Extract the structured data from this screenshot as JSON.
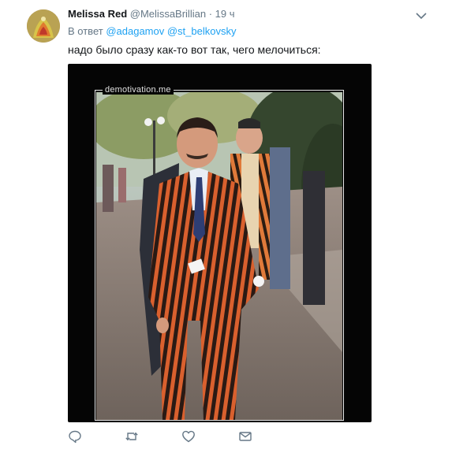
{
  "tweet": {
    "author": {
      "name": "Melissa Red",
      "handle": "@MelissaBrillian",
      "separator": "·",
      "time": "19 ч"
    },
    "reply": {
      "prefix": "В ответ",
      "mentions": [
        "@adagamov",
        "@st_belkovsky"
      ]
    },
    "text": "надо было сразу как-то вот так, чего мелочиться:",
    "media": {
      "watermark": "demotivation.me"
    },
    "actions": {
      "icons": [
        "reply-icon",
        "retweet-icon",
        "like-icon",
        "message-icon"
      ]
    }
  },
  "colors": {
    "link": "#1da1f2",
    "secondary_text": "#657786",
    "primary_text": "#14171a",
    "media_background": "#050505"
  }
}
